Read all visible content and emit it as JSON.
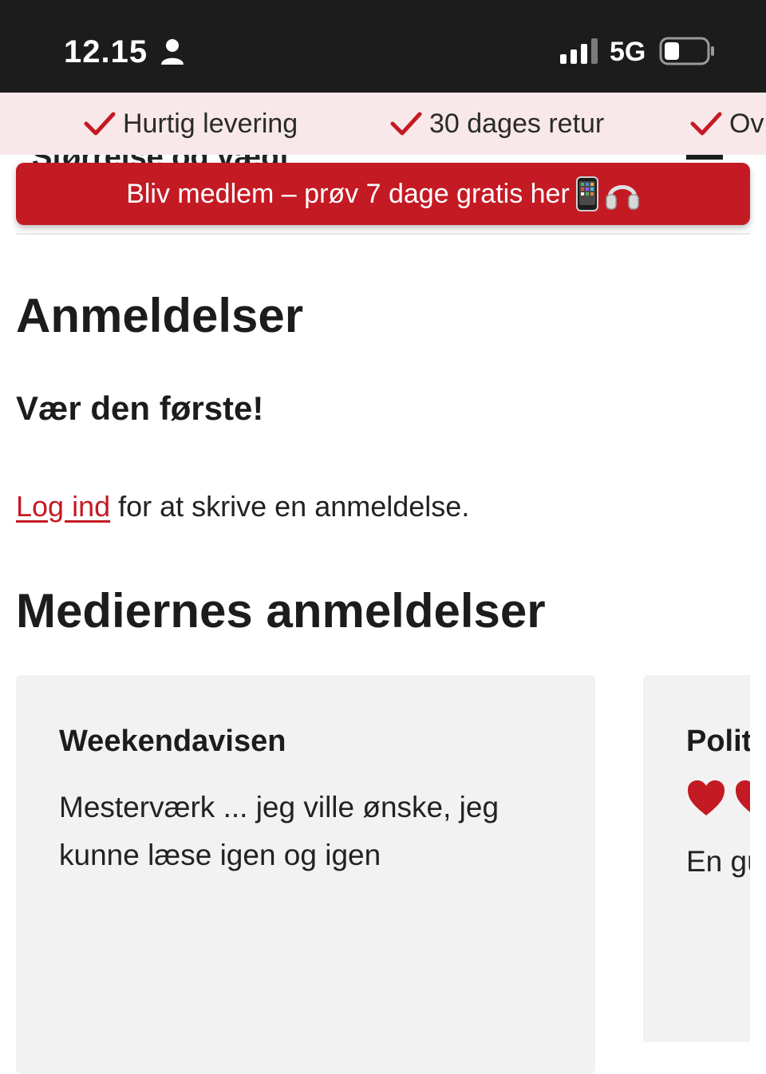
{
  "status_bar": {
    "time": "12.15",
    "network": "5G",
    "icons": [
      "person-icon",
      "signal-icon",
      "battery-icon"
    ]
  },
  "usp": {
    "items": [
      {
        "label": "Hurtig levering",
        "icon": "check-icon"
      },
      {
        "label": "30 dages retur",
        "icon": "check-icon"
      },
      {
        "label": "Ov",
        "icon": "check-icon"
      }
    ],
    "check_color": "#c41a24"
  },
  "hidden_section": {
    "title": "Størrelse og vægt"
  },
  "banner": {
    "text": "Bliv medlem – prøv 7 dage gratis her",
    "emojis": [
      "phone-icon",
      "headphones-icon"
    ],
    "color": "#c41a24"
  },
  "reviews": {
    "title": "Anmeldelser",
    "subtitle": "Vær den første!",
    "login_link": "Log ind",
    "login_rest": " for at skrive en anmeldelse."
  },
  "media_reviews": {
    "title": "Mediernes anmeldelser",
    "cards": [
      {
        "source": "Weekendavisen",
        "quote": "Mesterværk ... jeg ville ønske, jeg kunne læse igen og igen"
      },
      {
        "source": "Polit",
        "rating": "2 hearts visible",
        "quote": "En gu overs"
      }
    ]
  }
}
